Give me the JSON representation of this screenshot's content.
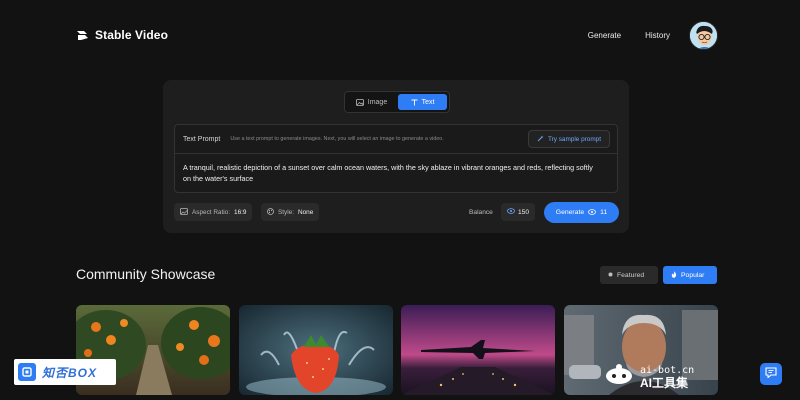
{
  "header": {
    "app_name": "Stable Video",
    "nav": [
      "Generate",
      "History"
    ]
  },
  "generator": {
    "modes": [
      {
        "label": "Image",
        "icon": "image-icon",
        "active": false
      },
      {
        "label": "Text",
        "icon": "text-icon",
        "active": true
      }
    ],
    "prompt_title": "Text Prompt",
    "prompt_hint": "Use a text prompt to generate images. Next, you will select an image to generate a video.",
    "sample_button": "Try sample prompt",
    "prompt_text": "A tranquil, realistic depiction of a sunset over calm ocean waters, with the sky ablaze in vibrant oranges and reds, reflecting softly on the water's surface",
    "aspect_label": "Aspect Ratio:",
    "aspect_value": "16:9",
    "style_label": "Style:",
    "style_value": "None",
    "balance_label": "Balance",
    "balance_value": "150",
    "generate_label": "Generate",
    "generate_cost": "11"
  },
  "showcase": {
    "title": "Community Showcase",
    "filters": [
      {
        "label": "Featured",
        "active": false
      },
      {
        "label": "Popular",
        "active": true
      }
    ]
  },
  "watermarks": {
    "left": "知否BOX",
    "right_top": "ai-bot.cn",
    "right_bottom": "AI工具集"
  },
  "colors": {
    "accent": "#2f7df5",
    "background": "#121212",
    "panel": "#1e1e1f"
  }
}
